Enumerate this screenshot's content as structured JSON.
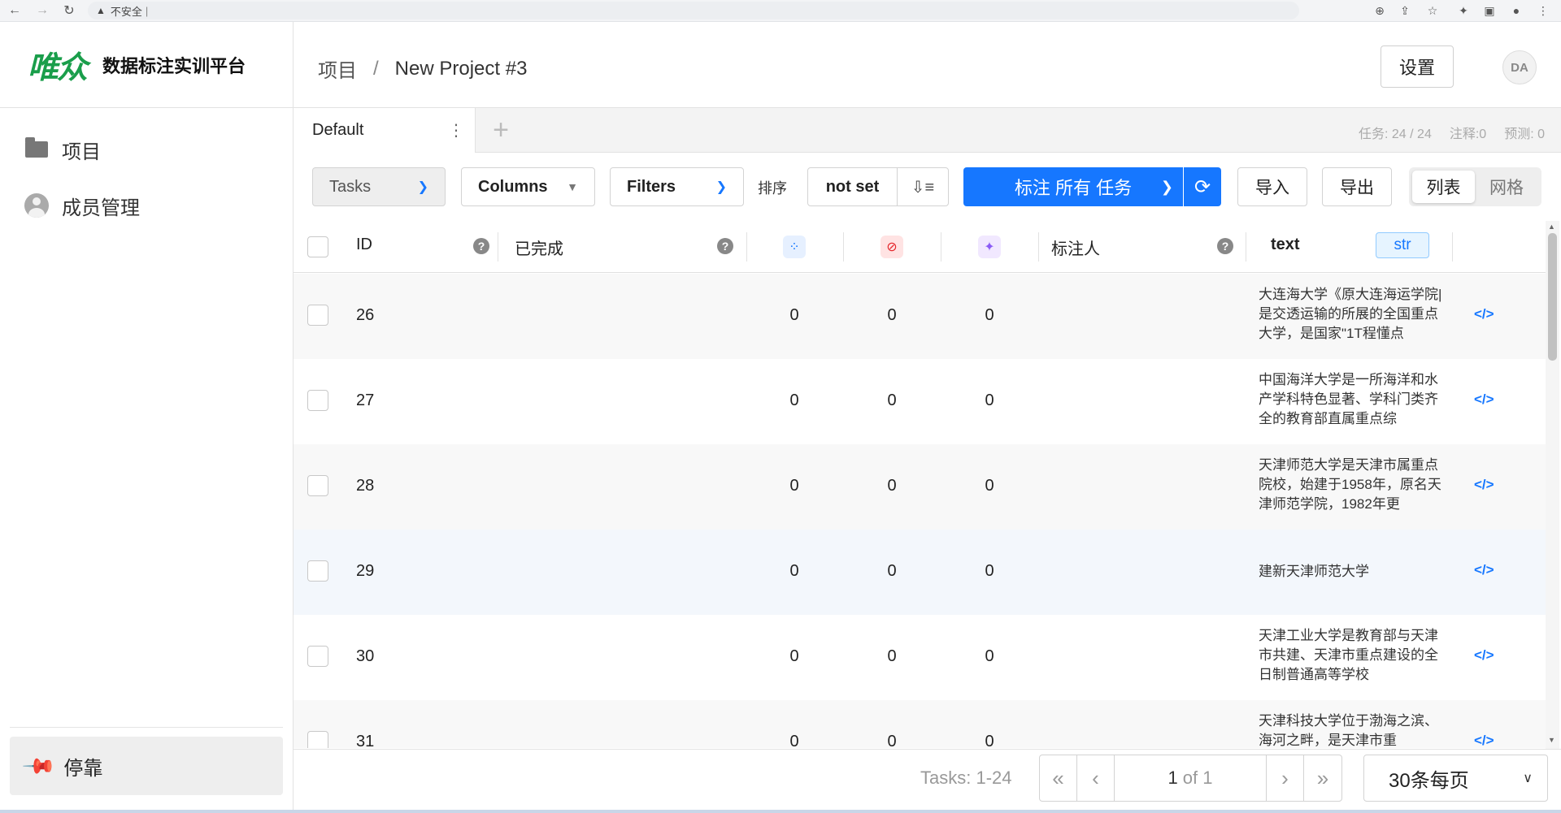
{
  "browser": {
    "security_label": "不安全",
    "address_text": "|"
  },
  "sidebar": {
    "logo_mark": "唯众",
    "logo_text": "数据标注实训平台",
    "items": [
      {
        "label": "项目",
        "icon": "folder-icon"
      },
      {
        "label": "成员管理",
        "icon": "user-icon"
      }
    ],
    "dock_label": "停靠"
  },
  "header": {
    "breadcrumb_root": "项目",
    "breadcrumb_sep": "/",
    "project_name": "New Project #3",
    "settings_label": "设置",
    "avatar_initials": "DA"
  },
  "tabs": {
    "active": "Default",
    "add_label": "+",
    "stats": {
      "tasks": "任务: 24 / 24",
      "annotations": "注释:0",
      "predictions": "预测: 0"
    }
  },
  "toolbar": {
    "tasks_label": "Tasks",
    "columns_label": "Columns",
    "filters_label": "Filters",
    "sort_label": "排序",
    "sort_value": "not set",
    "label_all": "标注 所有 任务",
    "import_label": "导入",
    "export_label": "导出",
    "view_list": "列表",
    "view_grid": "网格"
  },
  "table": {
    "columns": {
      "id": "ID",
      "completed": "已完成",
      "annotator": "标注人",
      "text": "text",
      "text_type": "str"
    },
    "rows": [
      {
        "id": "26",
        "total": "0",
        "cancelled": "0",
        "predictions": "0",
        "text": "大连海大学《原大连海运学院|是交透运输的所展的全国重点大学，是国家\"1T程懂点"
      },
      {
        "id": "27",
        "total": "0",
        "cancelled": "0",
        "predictions": "0",
        "text": "中国海洋大学是一所海洋和水产学科特色显著、学科门类齐全的教育部直属重点综"
      },
      {
        "id": "28",
        "total": "0",
        "cancelled": "0",
        "predictions": "0",
        "text": "天津师范大学是天津市属重点院校，始建于1958年，原名天津师范学院，1982年更"
      },
      {
        "id": "29",
        "total": "0",
        "cancelled": "0",
        "predictions": "0",
        "text": "建新天津师范大学"
      },
      {
        "id": "30",
        "total": "0",
        "cancelled": "0",
        "predictions": "0",
        "text": "天津工业大学是教育部与天津市共建、天津市重点建设的全日制普通高等学校"
      },
      {
        "id": "31",
        "total": "0",
        "cancelled": "0",
        "predictions": "0",
        "text": "天津科技大学位于渤海之滨、海河之畔，是天津市重"
      }
    ]
  },
  "footer": {
    "tasks_range": "Tasks: 1-24",
    "page_current": "1",
    "page_of": "of 1",
    "per_page": "30条每页"
  },
  "colors": {
    "accent": "#1677ff",
    "brand_green": "#1a9e4b"
  }
}
